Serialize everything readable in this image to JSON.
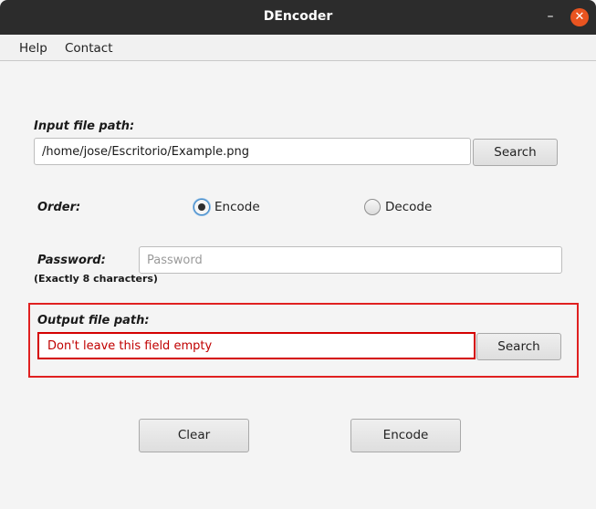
{
  "window": {
    "title": "DEncoder",
    "minimize_glyph": "–",
    "close_glyph": "✕",
    "close_color": "#e95420"
  },
  "menu": {
    "items": [
      "Help",
      "Contact"
    ]
  },
  "input": {
    "label": "Input file path:",
    "value": "/home/jose/Escritorio/Example.png",
    "search_label": "Search"
  },
  "order": {
    "label": "Order:",
    "options": [
      "Encode",
      "Decode"
    ],
    "selected": "Encode"
  },
  "password": {
    "label": "Password:",
    "note": "(Exactly 8 characters)",
    "placeholder": "Password"
  },
  "output": {
    "label": "Output file path:",
    "error_text": "Don't leave this field empty",
    "search_label": "Search",
    "error_color": "#d40000"
  },
  "actions": {
    "clear_label": "Clear",
    "encode_label": "Encode"
  }
}
